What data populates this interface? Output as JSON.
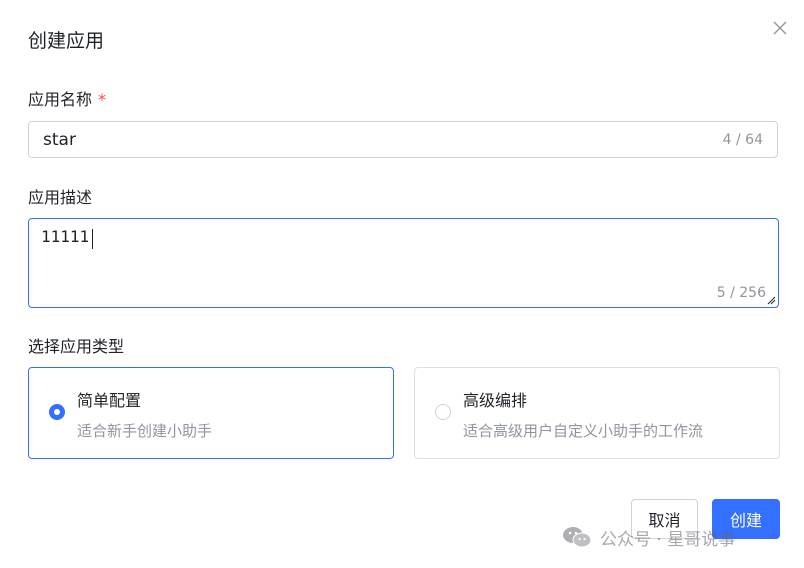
{
  "dialog": {
    "title": "创建应用",
    "close_icon": "close-icon"
  },
  "app_name": {
    "label": "应用名称",
    "required_mark": "*",
    "value": "star",
    "counter": "4 / 64"
  },
  "app_desc": {
    "label": "应用描述",
    "value": "11111",
    "counter": "5 / 256"
  },
  "app_type": {
    "label": "选择应用类型",
    "options": [
      {
        "title": "简单配置",
        "desc": "适合新手创建小助手",
        "selected": true
      },
      {
        "title": "高级编排",
        "desc": "适合高级用户自定义小助手的工作流",
        "selected": false
      }
    ]
  },
  "footer": {
    "cancel_label": "取消",
    "create_label": "创建"
  },
  "watermark": {
    "text": "公众号 · 星哥说事",
    "icon": "wechat-icon"
  },
  "colors": {
    "accent": "#3370ff",
    "required": "#f54a45",
    "muted_text": "#8f959e",
    "border": "#d0d3d6"
  }
}
